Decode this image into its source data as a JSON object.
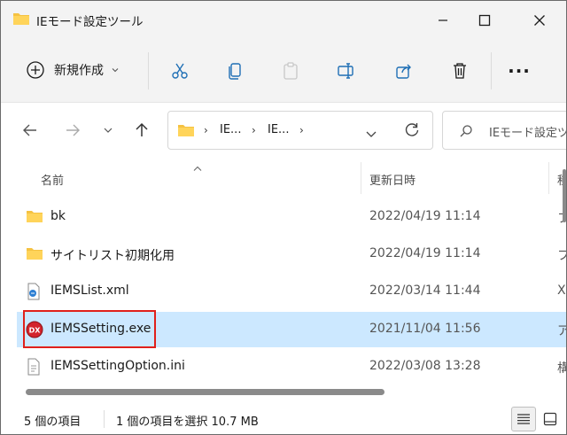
{
  "window": {
    "title": "IEモード設定ツール",
    "min_glyph": "—",
    "close_glyph": "✕"
  },
  "toolbar": {
    "new_label": "新規作成",
    "more_glyph": "···"
  },
  "address": {
    "crumbs": [
      "IE...",
      "IE..."
    ],
    "sep_glyph": "›",
    "search_placeholder": "IEモード設定ツ"
  },
  "columns": {
    "name": "名前",
    "date": "更新日時",
    "type": "種"
  },
  "files": [
    {
      "name": "bk",
      "date": "2022/04/19 11:14",
      "type": "フ",
      "icon": "folder-icon"
    },
    {
      "name": "サイトリスト初期化用",
      "date": "2022/04/19 11:14",
      "type": "フ",
      "icon": "folder-icon"
    },
    {
      "name": "IEMSList.xml",
      "date": "2022/03/14 11:44",
      "type": "X",
      "icon": "xml-file-icon"
    },
    {
      "name": "IEMSSetting.exe",
      "date": "2021/11/04 11:56",
      "type": "ア",
      "icon": "dx-app-icon",
      "selected": true
    },
    {
      "name": "IEMSSettingOption.ini",
      "date": "2022/03/08 13:28",
      "type": "構",
      "icon": "ini-file-icon"
    }
  ],
  "status": {
    "item_count": "5 個の項目",
    "selection": "1 個の項目を選択  10.7 MB"
  },
  "colors": {
    "selected_row": "#cce8ff",
    "highlight_box": "#e0201b",
    "folder": "#f5c242",
    "accent": "#0067c0"
  }
}
